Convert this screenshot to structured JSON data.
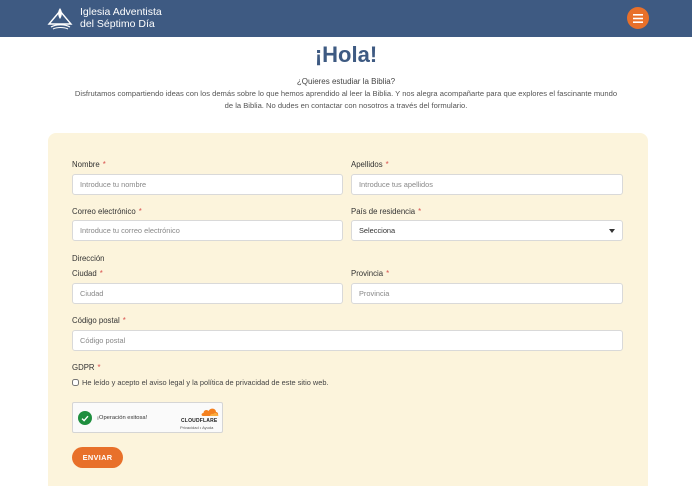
{
  "header": {
    "logo_line1": "Iglesia Adventista",
    "logo_line2": "del Séptimo Día",
    "logo_icon": "adventist-flame-icon",
    "menu_icon": "hamburger-menu-icon",
    "bar_color": "#3e5a82",
    "accent_color": "#e8702a"
  },
  "hero": {
    "title": "¡Hola!",
    "subtitle": "¿Quieres estudiar la Biblia?",
    "intro_line1": "Disfrutamos compartiendo ideas con los demás sobre lo que hemos aprendido al leer la Biblia. Y nos alegra acompañarte para que explores el fascinante mundo",
    "intro_line2": "de la Biblia. No dudes en contactar con nosotros a través del formulario."
  },
  "form": {
    "background": "#fcf4dc",
    "required_mark": "*",
    "nombre": {
      "label": "Nombre",
      "placeholder": "Introduce tu nombre",
      "value": ""
    },
    "apellidos": {
      "label": "Apellidos",
      "placeholder": "Introduce tus apellidos",
      "value": ""
    },
    "correo": {
      "label": "Correo electrónico",
      "placeholder": "Introduce tu correo electrónico",
      "value": ""
    },
    "pais": {
      "label": "País de residencia",
      "selected": "Selecciona"
    },
    "direccion_label": "Dirección",
    "ciudad": {
      "label": "Ciudad",
      "placeholder": "Ciudad",
      "value": ""
    },
    "provincia": {
      "label": "Provincia",
      "placeholder": "Provincia",
      "value": ""
    },
    "codigo_postal": {
      "label": "Código postal",
      "placeholder": "Código postal",
      "value": ""
    },
    "gdpr": {
      "label": "GDPR",
      "checkbox_text": "He leído y acepto el aviso legal y la política de privacidad de este sitio web."
    },
    "captcha": {
      "status": "¡Operación exitosa!",
      "brand": "CLOUDFLARE",
      "links": "Privacidad • Ayuda",
      "check_icon": "success-check-icon"
    },
    "submit_label": "ENVIAR"
  }
}
